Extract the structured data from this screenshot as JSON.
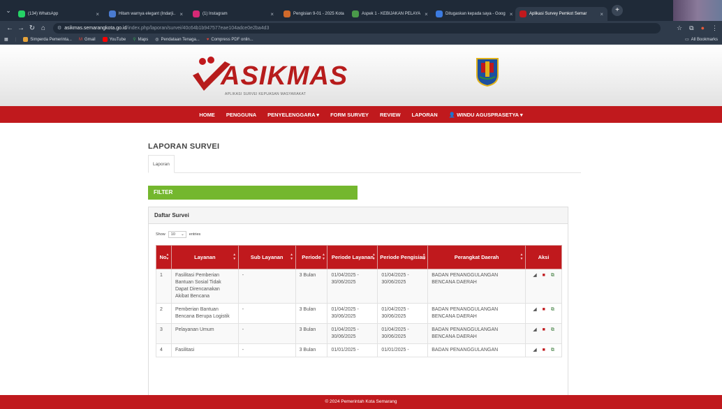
{
  "browser": {
    "tabs": [
      {
        "label": "(134) WhatsApp",
        "color": "#25d366"
      },
      {
        "label": "Hitam warnya elegant (Indarji..",
        "color": "#4a7bd0"
      },
      {
        "label": "(1) Instagram",
        "color": "#d62976"
      },
      {
        "label": "Pengisian 9-01 - 2025 Kota",
        "color": "#d06a2b"
      },
      {
        "label": "Aspek 1 - KEBIJAKAN PELAYA",
        "color": "#4a9a4a"
      },
      {
        "label": "Ditugaskan kepada saya - Goog",
        "color": "#3c7be0"
      },
      {
        "label": "Aplikasi Survey Pemkot Semar",
        "color": "#c0191d",
        "active": true
      }
    ],
    "url_host": "asikmas.semarangkota.go.id",
    "url_path": "/index.php/laporan/survei/40c64b1b947577eae104adce0e2ba4d3",
    "bookmarks": [
      "Simperda Pemerinta...",
      "Gmail",
      "YouTube",
      "Maps",
      "Pendataan Tenaga...",
      "Compress PDF onlin..."
    ],
    "bookmarks_right": "All Bookmarks"
  },
  "site": {
    "logo_text": "ASIKMAS",
    "logo_sub": "APLIKASI SURVEI KEPUASAN MASYARAKAT",
    "nav": [
      "HOME",
      "PENGGUNA",
      "PENYELENGGARA ▾",
      "FORM SURVEY",
      "REVIEW",
      "LAPORAN",
      "👤 WINDU AGUSPRASETYA ▾"
    ]
  },
  "content": {
    "title": "LAPORAN SURVEI",
    "crumb": "Laporan",
    "filter": "FILTER",
    "panel_title": "Daftar Survei",
    "show_label": "Show",
    "show_value": "10",
    "entries_label": "entries",
    "columns": [
      "No.",
      "Layanan",
      "Sub Layanan",
      "Periode",
      "Periode Layanan",
      "Periode Pengisian",
      "Perangkat Daerah",
      "Aksi"
    ],
    "rows": [
      {
        "no": "1",
        "layanan": "Fasilitasi Pemberian Bantuan Sosial Tidak Dapat Direncanakan Akibat Bencana",
        "sub": "-",
        "periode": "3 Bulan",
        "p_layanan": "01/04/2025 - 30/06/2025",
        "p_pengisian": "01/04/2025 - 30/06/2025",
        "perangkat": "BADAN PENANGGULANGAN BENCANA DAERAH"
      },
      {
        "no": "2",
        "layanan": "Pemberian Bantuan Bencana Berupa Logistik",
        "sub": "-",
        "periode": "3 Bulan",
        "p_layanan": "01/04/2025 - 30/06/2025",
        "p_pengisian": "01/04/2025 - 30/06/2025",
        "perangkat": "BADAN PENANGGULANGAN BENCANA DAERAH"
      },
      {
        "no": "3",
        "layanan": "Pelayanan Umum",
        "sub": "-",
        "periode": "3 Bulan",
        "p_layanan": "01/04/2025 - 30/06/2025",
        "p_pengisian": "01/04/2025 - 30/06/2025",
        "perangkat": "BADAN PENANGGULANGAN BENCANA DAERAH"
      },
      {
        "no": "4",
        "layanan": "Fasilitasi",
        "sub": "-",
        "periode": "3 Bulan",
        "p_layanan": "01/01/2025 -",
        "p_pengisian": "01/01/2025 -",
        "perangkat": "BADAN PENANGGULANGAN"
      }
    ],
    "footer": "© 2024 Pemerintah Kota Semarang"
  },
  "colors": {
    "brand_red": "#c0191d",
    "filter_green": "#74b72e"
  }
}
